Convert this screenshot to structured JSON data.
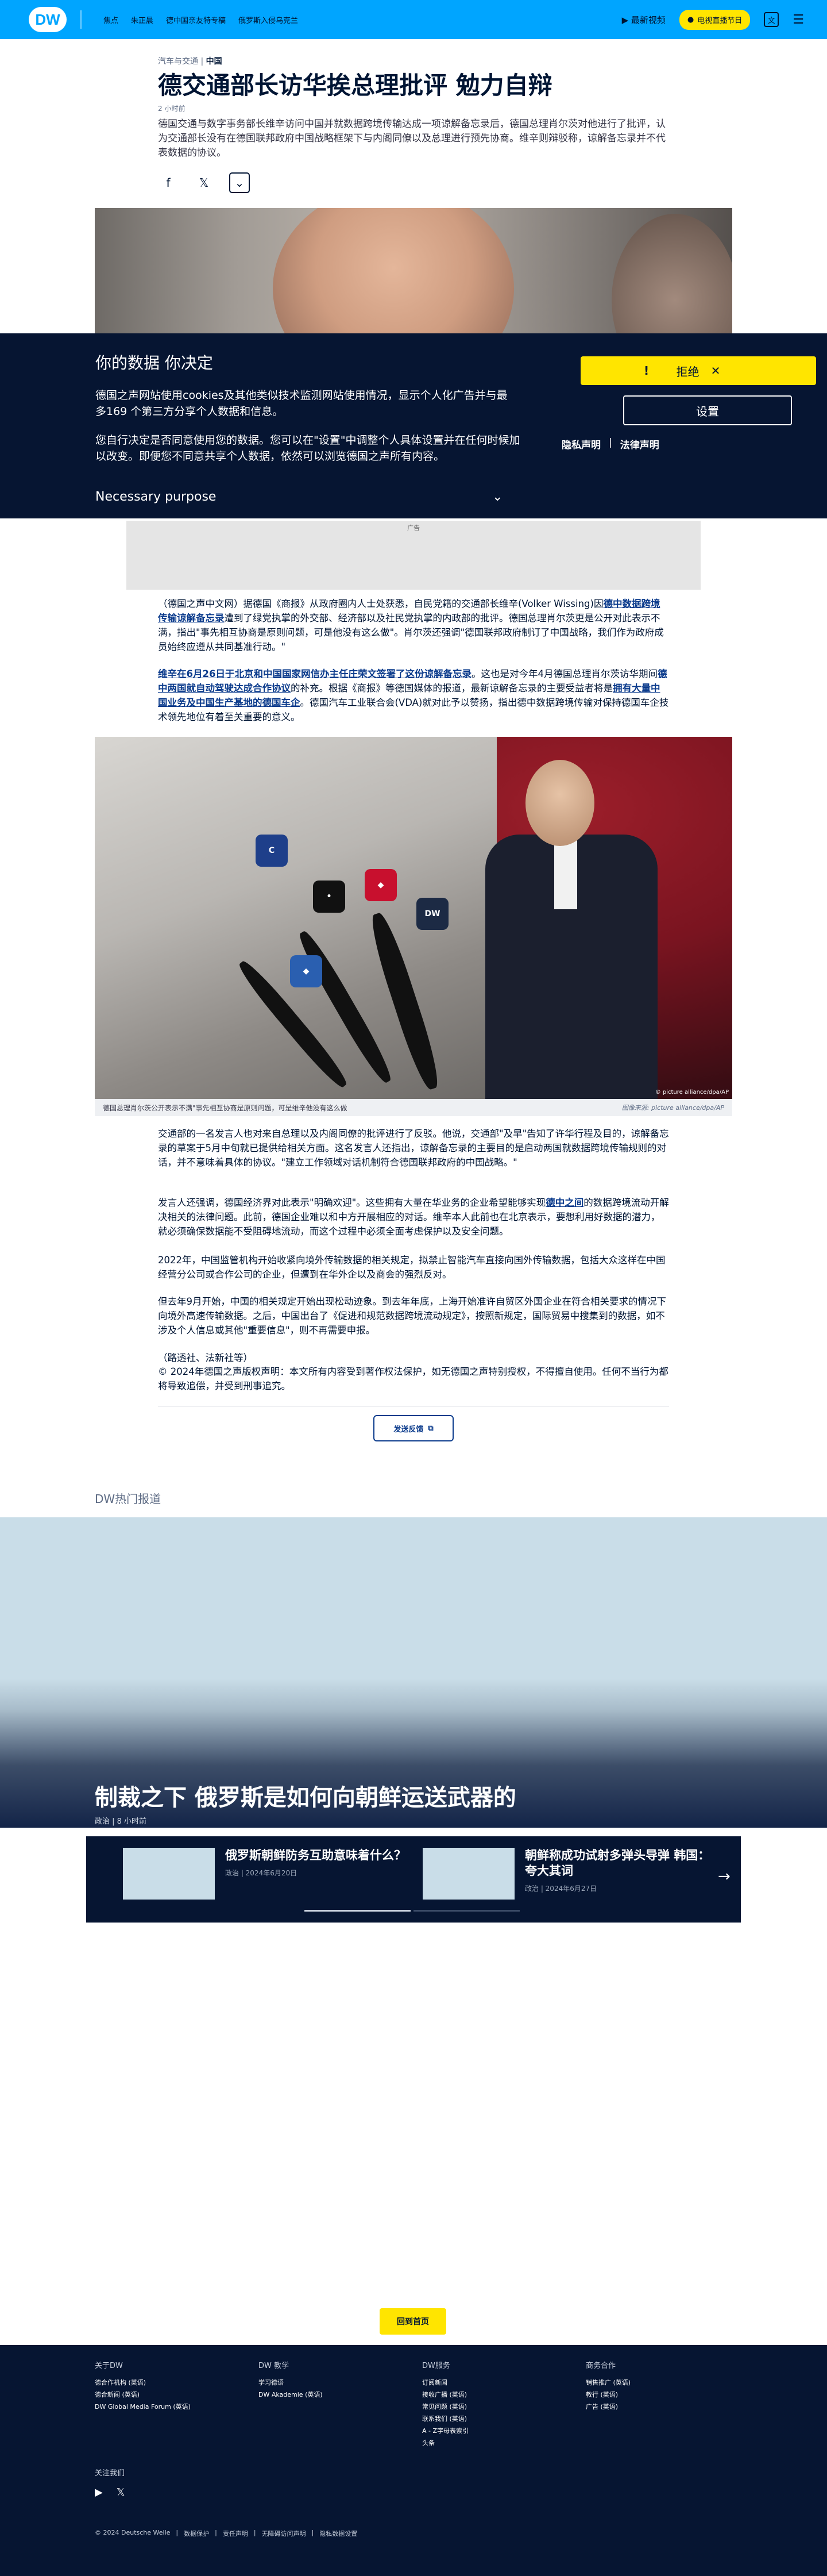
{
  "header": {
    "logo": "DW",
    "nav_items": [
      "焦点",
      "朱正晨",
      "德中国亲友特专稿",
      "俄罗斯入侵乌克兰"
    ],
    "latest_video": "最新视频",
    "tv_button": "电视直播节目",
    "lang": "文"
  },
  "article": {
    "category": "汽车与交通",
    "region": "中国",
    "title": "德交通部长访华挨总理批评 勉力自辩",
    "time": "2 小时前",
    "lead": "德国交通与数字事务部长维辛访问中国并就数据跨境传输达成一项谅解备忘录后，德国总理肖尔茨对他进行了批评，认为交通部长没有在德国联邦政府中国战略框架下与内阁同僚以及总理进行预先协商。维辛则辩驳称，谅解备忘录并不代表数据的协议。",
    "p1_a": "（德国之声中文网）据德国《商报》从政府圈内人士处获悉，自民党籍的交通部长维辛(Volker Wissing)因",
    "p1_link": "德中数据跨境传输谅解备忘录",
    "p1_b": "遭到了绿党执掌的外交部、经济部以及社民党执掌的内政部的批评。德国总理肖尔茨更是公开对此表示不满，指出\"事先相互协商是原则问题，可是他没有这么做\"。肖尔茨还强调\"德国联邦政府制订了中国战略，我们作为政府成员始终应遵从共同基准行动。\"",
    "p2_link": "维辛在6月26日于北京和中国国家网信办主任庄荣文签署了这份谅解备忘录",
    "p2_a": "。这也是对今年4月德国总理肖尔茨访华期间",
    "p2_link2": "德中两国就自动驾驶达成合作协议",
    "p2_b": "的补充。根据《商报》等德国媒体的报道，最新谅解备忘录的主要受益者将是",
    "p2_link3": "拥有大量中国业务及中国生产基地的德国车企",
    "p2_c": "。德国汽车工业联合会(VDA)就对此予以赞扬，指出德中数据跨境传输对保持德国车企技术领先地位有着至关重要的意义。",
    "photo_caption": "德国总理肖尔茨公开表示不满\"事先相互协商是原则问题，可是维辛他没有这么做",
    "photo_credit": "图像来源: picture alliance/dpa/AP",
    "photo_watermark": "© picture alliance/dpa/AP",
    "p3": "交通部的一名发言人也对来自总理以及内阁同僚的批评进行了反驳。他说，交通部\"及早\"告知了许华行程及目的，谅解备忘录的草案于5月中旬就已提供给相关方面。这名发言人还指出，谅解备忘录的主要目的是启动两国就数据跨境传输规则的对话，并不意味着具体的协议。\"建立工作领域对话机制符合德国联邦政府的中国战略。\"",
    "p4_a": "发言人还强调，德国经济界对此表示\"明确欢迎\"。这些拥有大量在华业务的企业希望能够实现",
    "p4_link": "德中之间",
    "p4_b": "的数据跨境流动开解决相关的法律问题。此前，德国企业难以和中方开展相应的对话。维辛本人此前也在北京表示，要想利用好数据的潜力，就必须确保数据能不受阻碍地流动，而这个过程中必须全面考虑保护以及安全问题。",
    "p5": "2022年，中国监管机构开始收紧向境外传输数据的相关规定，拟禁止智能汽车直接向国外传输数据，包括大众这样在中国经营分公司或合作公司的企业，但遭到在华外企以及商会的强烈反对。",
    "p6": "但去年9月开始，中国的相关规定开始出现松动迹象。到去年年底，上海开始准许自贸区外国企业在符合相关要求的情况下向境外高速传输数据。之后，中国出台了《促进和规范数据跨境流动规定》，按照新规定，国际贸易中搜集到的数据，如不涉及个人信息或其他\"重要信息\"，则不再需要申报。",
    "source": "（路透社、法新社等）",
    "copyright": "© 2024年德国之声版权声明：本文所有内容受到著作权法保护，如无德国之声特别授权，不得擅自使用。任何不当行为都将导致追偿，并受到刑事追究。",
    "feedback": "发送反馈"
  },
  "ad": {
    "label": "广告"
  },
  "cookie": {
    "title": "你的数据 你决定",
    "p1": "德国之声网站使用cookies及其他类似技术监测网站使用情况，显示个人化广告并与最多169 个第三方分享个人数据和信息。",
    "p2": "您自行决定是否同意使用您的数据。您可以在\"设置\"中调整个人具体设置并在任何时候加以改变。即便您不同意共享个人数据，依然可以浏览德国之声所有内容。",
    "reject": "拒绝",
    "settings": "设置",
    "privacy": "隐私声明",
    "legal": "法律声明",
    "necessary": "Necessary purpose"
  },
  "popular": {
    "heading": "DW热门报道",
    "main_title": "制裁之下 俄罗斯是如何向朝鲜运送武器的",
    "main_meta": "政治 | 8 小时前",
    "cards": [
      {
        "title": "俄罗斯朝鲜防务互助意味着什么？",
        "meta": "政治 | 2024年6月20日"
      },
      {
        "title": "朝鲜称成功试射多弹头导弹 韩国：夸大其词",
        "meta": "政治 | 2024年6月27日"
      }
    ]
  },
  "back_top": "回到首页",
  "footer": {
    "col1": {
      "heading": "关于DW",
      "items": [
        "德合作机构 (英语)",
        "德合新闻 (英语)",
        "DW Global Media Forum (英语)"
      ]
    },
    "col2": {
      "heading": "DW 教学",
      "items": [
        "学习德语",
        "DW Akademie (英语)"
      ]
    },
    "col3": {
      "heading": "DW服务",
      "items": [
        "订阅新闻",
        "接收广播 (英语)",
        "常见问题 (英语)",
        "联系我们 (英语)",
        "A - Z字母表索引",
        "头条"
      ]
    },
    "col4": {
      "heading": "商务合作",
      "items": [
        "销售推广 (英语)",
        "教行 (英语)",
        "广告 (英语)"
      ]
    },
    "follow": "关注我们",
    "bottom": [
      "© 2024 Deutsche Welle",
      "数据保护",
      "责任声明",
      "无障碍访问声明",
      "隐私数据设置"
    ]
  },
  "colors": {
    "header": "#00a5ff",
    "accent": "#ffe500",
    "dark": "#061532",
    "link": "#0b3b8c"
  }
}
